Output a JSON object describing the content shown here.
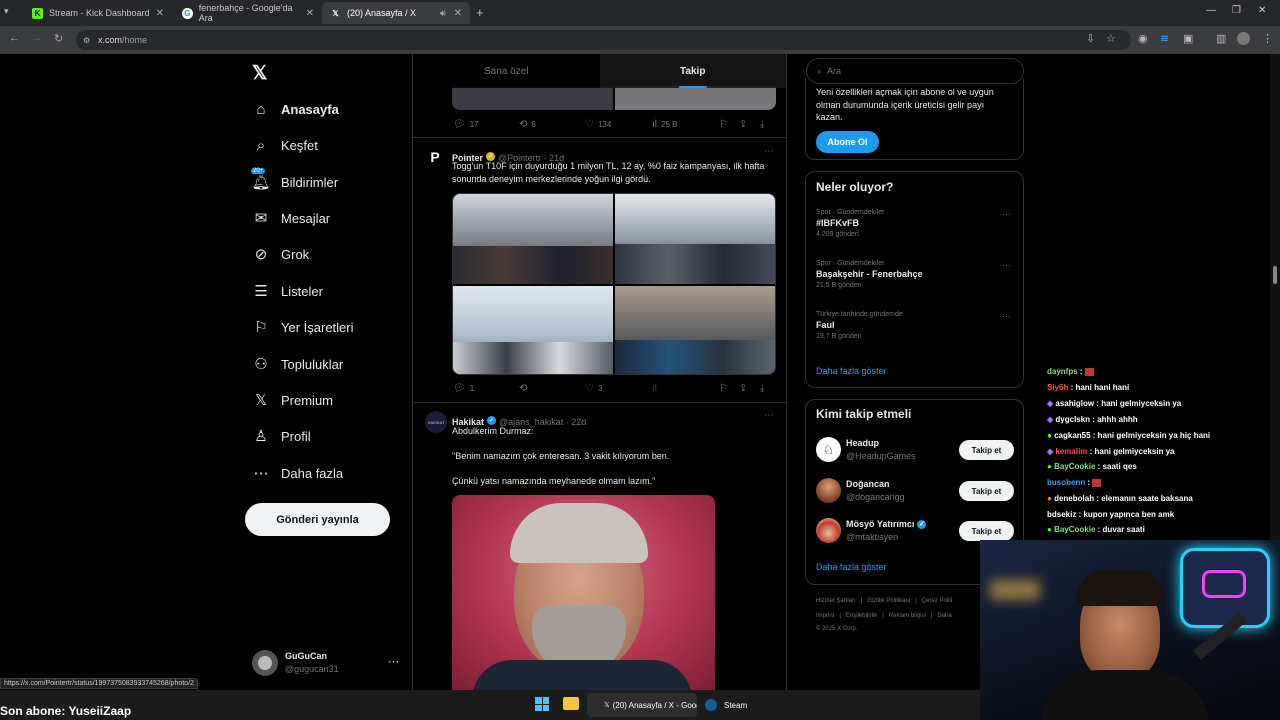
{
  "browser": {
    "tabs": [
      {
        "title": "Stream - Kick Dashboard",
        "icon": "kick-icon",
        "active": false
      },
      {
        "title": "fenerbahçe - Google'da Ara",
        "icon": "google-icon",
        "active": false
      },
      {
        "title": "(20) Anasayfa / X",
        "icon": "x-logo-icon",
        "active": true
      }
    ],
    "url_domain": "x.com",
    "url_path": "/home",
    "status_url": "https://x.com/Pointertr/status/1997375083933745268/photo/2"
  },
  "nav": {
    "items": [
      {
        "label": "Anasayfa",
        "icon": "home-icon",
        "bold": true
      },
      {
        "label": "Keşfet",
        "icon": "search-icon"
      },
      {
        "label": "Bildirimler",
        "icon": "bell-icon",
        "badge": "20+"
      },
      {
        "label": "Mesajlar",
        "icon": "mail-icon"
      },
      {
        "label": "Grok",
        "icon": "grok-icon"
      },
      {
        "label": "Listeler",
        "icon": "list-icon"
      },
      {
        "label": "Yer İşaretleri",
        "icon": "bookmark-icon"
      },
      {
        "label": "Topluluklar",
        "icon": "community-icon"
      },
      {
        "label": "Premium",
        "icon": "x-logo-icon"
      },
      {
        "label": "Profil",
        "icon": "profile-icon"
      },
      {
        "label": "Daha fazla",
        "icon": "more-icon"
      }
    ],
    "post_button": "Gönderi yayınla",
    "account": {
      "name": "GuGuCan",
      "handle": "@gugucan31"
    }
  },
  "feed": {
    "tabs": [
      "Sana özel",
      "Takip"
    ],
    "active_tab": "Takip",
    "prev_post_stats": {
      "replies": "17",
      "reposts": "6",
      "likes": "134",
      "views": "25 B"
    },
    "posts": [
      {
        "name": "Pointer",
        "handle": "@Pointertr",
        "time": "21d",
        "text": "Togg'un T10F için duyurduğu 1 milyon TL, 12 ay, %0 faiz kampanyası, ilk hafta sonunda deneyim merkezlerinde yoğun ilgi gördü.",
        "stats": {
          "replies": "1",
          "reposts": "",
          "likes": "3",
          "views": ""
        }
      },
      {
        "name": "Hakikat",
        "handle": "@ajans_hakikat",
        "time": "22d",
        "line1": "Abdulkerim Durmaz:",
        "line2": "\"Benim namazım çok enteresan. 3 vakit kılıyorum ben.",
        "line3": "Çünkü yatsı namazında meyhanede olmam lazım.\""
      }
    ]
  },
  "sidebar": {
    "search_placeholder": "Ara",
    "premium_text": "Yeni özellikleri açmak için abone ol ve uygun olman durumunda içerik üreticisi gelir payı kazan.",
    "subscribe_button": "Abone Ol",
    "trends_title": "Neler oluyor?",
    "trends": [
      {
        "category": "Spor · Gündemdekiler",
        "name": "#IBFKvFB",
        "count": "4.209 gönderi"
      },
      {
        "category": "Spor · Gündemdekiler",
        "name": "Başakşehir - Fenerbahçe",
        "count": "21,5 B gönderi"
      },
      {
        "category": "Türkiye tarihinde gündemde",
        "name": "Faul",
        "count": "19,7 B gönderi"
      }
    ],
    "show_more": "Daha fazla göster",
    "who_title": "Kimi takip etmeli",
    "who": [
      {
        "name": "Headup",
        "handle": "@HeadupGames",
        "verified": false
      },
      {
        "name": "Doğancan",
        "handle": "@dogancangg",
        "verified": false
      },
      {
        "name": "Mösyö Yatırımcı",
        "handle": "@mtaktisyen",
        "verified": true
      }
    ],
    "follow_label": "Takip et",
    "footer_row1": [
      "Hizmet Şartları",
      "Gizlilik Politikası",
      "Çerez Politi"
    ],
    "footer_row2": [
      "Imprint",
      "Erişilebilirlik",
      "Reklam bilgisi",
      "Daha"
    ],
    "copyright": "© 2025 X Corp."
  },
  "chat": {
    "messages": [
      {
        "user": "daynfps",
        "text": "",
        "color": "#7ee081",
        "emote": true
      },
      {
        "user": "Siy6h",
        "text": "hani hani hani",
        "color": "#ff4b4b"
      },
      {
        "user": "asahiglow",
        "text": "hani gelmiyceksin ya",
        "color": "#ffffff"
      },
      {
        "user": "dygclskn",
        "text": "ahhh ahhh",
        "color": "#ffffff"
      },
      {
        "user": "cagkan55",
        "text": "hani gelmiyceksin ya hiç hani",
        "color": "#ffffff"
      },
      {
        "user": "kemalim",
        "text": "hani gelmiyceksin ya",
        "color": "#ff4b4b"
      },
      {
        "user": "BayCookie",
        "text": "saati qes",
        "color": "#7ee081"
      },
      {
        "user": "busobenn",
        "text": "",
        "color": "#3aa0ff",
        "emote": true
      },
      {
        "user": "denebolah",
        "text": "elemanın saate baksana",
        "color": "#ffffff"
      },
      {
        "user": "bdsekiz",
        "text": "kupon yapınca ben amk",
        "color": "#ffffff"
      },
      {
        "user": "BayCookie",
        "text": "duvar saati",
        "color": "#7ee081"
      }
    ]
  },
  "overlay": {
    "last_sub": "Son abone: YuseiiZaap"
  },
  "taskbar": {
    "apps": [
      {
        "label": "(20) Anasayfa / X - Goog",
        "icon": "chrome-icon"
      },
      {
        "label": "Steam",
        "icon": "steam-icon"
      }
    ]
  },
  "colors": {
    "accent": "#1d9bf0",
    "background": "#000000",
    "border": "#2f3336",
    "muted": "#71767b"
  }
}
